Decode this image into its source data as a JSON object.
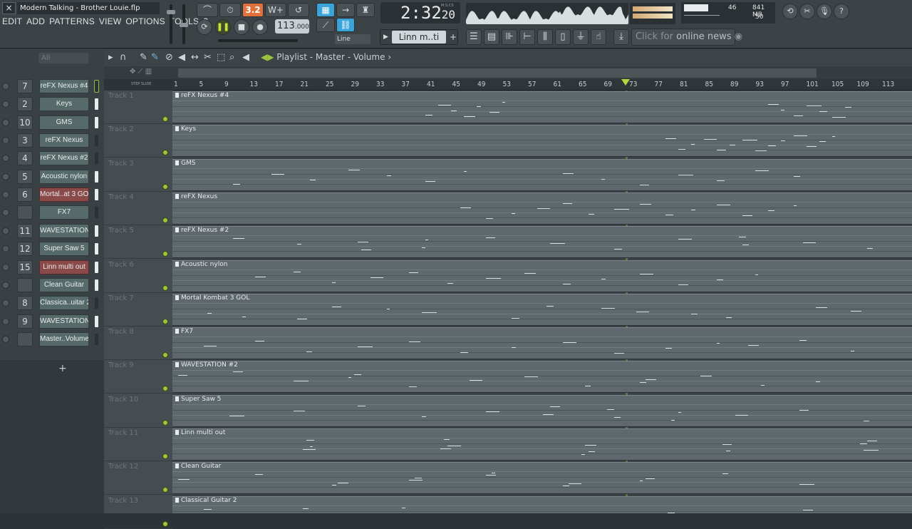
{
  "window": {
    "title": "Modern Talking - Brother Louie.flp",
    "close_label": "×"
  },
  "menu": [
    "EDIT",
    "ADD",
    "PATTERNS",
    "VIEW",
    "OPTIONS",
    "TOOLS",
    "?"
  ],
  "transport": {
    "tempo_int": "113",
    "tempo_frac": ".000",
    "time_main": "2:32",
    "time_sub": "20",
    "time_unit": "M:S:CS",
    "snap": "3.2",
    "line_mode": "Line",
    "pattern_name": "Linn m..ti out"
  },
  "status": {
    "cpu": "46",
    "memory": "841 MB",
    "polyphony": "50"
  },
  "news": {
    "prefix": "Click for",
    "link": "online news"
  },
  "channel_filter": "All",
  "channels": [
    {
      "num": "7",
      "name": "reFX Nexus #4",
      "style": "normal",
      "selected": "green"
    },
    {
      "num": "2",
      "name": "Keys",
      "style": "normal",
      "selected": "on"
    },
    {
      "num": "10",
      "name": "GMS",
      "style": "normal",
      "selected": "on"
    },
    {
      "num": "3",
      "name": "reFX Nexus",
      "style": "normal",
      "selected": "off"
    },
    {
      "num": "4",
      "name": "reFX Nexus #2",
      "style": "normal",
      "selected": "off"
    },
    {
      "num": "5",
      "name": "Acoustic nylon",
      "style": "normal",
      "selected": "on"
    },
    {
      "num": "6",
      "name": "Mortal..at 3 GOL",
      "style": "red",
      "selected": "on"
    },
    {
      "num": "",
      "name": "FX7",
      "style": "normal",
      "selected": "off"
    },
    {
      "num": "11",
      "name": "WAVESTATION #2",
      "style": "normal",
      "selected": "on"
    },
    {
      "num": "12",
      "name": "Super Saw 5",
      "style": "normal",
      "selected": "on"
    },
    {
      "num": "15",
      "name": "Linn multi out",
      "style": "red",
      "selected": "on"
    },
    {
      "num": "",
      "name": "Clean Guitar",
      "style": "normal",
      "selected": "on"
    },
    {
      "num": "8",
      "name": "Classica..uitar 2",
      "style": "normal",
      "selected": "off"
    },
    {
      "num": "9",
      "name": "WAVESTATION",
      "style": "normal",
      "selected": "on"
    },
    {
      "num": "",
      "name": "Master..Volume",
      "style": "normal",
      "selected": "off"
    }
  ],
  "add_channel": "+",
  "playlist": {
    "title": "Playlist - Master - Volume",
    "step_label": "STEP SLIDE",
    "ruler": [
      "1",
      "5",
      "9",
      "13",
      "17",
      "21",
      "25",
      "29",
      "33",
      "37",
      "41",
      "45",
      "49",
      "53",
      "57",
      "61",
      "65",
      "69",
      "73",
      "77",
      "81",
      "85",
      "89",
      "93",
      "97",
      "101",
      "105",
      "109",
      "113"
    ],
    "tracks": [
      {
        "label": "Track 1",
        "clip": "reFX Nexus #4"
      },
      {
        "label": "Track 2",
        "clip": "Keys"
      },
      {
        "label": "Track 3",
        "clip": "GMS"
      },
      {
        "label": "Track 4",
        "clip": "reFX Nexus"
      },
      {
        "label": "Track 5",
        "clip": "reFX Nexus #2"
      },
      {
        "label": "Track 6",
        "clip": "Acoustic nylon"
      },
      {
        "label": "Track 7",
        "clip": "Mortal Kombat 3 GOL"
      },
      {
        "label": "Track 8",
        "clip": "FX7"
      },
      {
        "label": "Track 9",
        "clip": "WAVESTATION #2"
      },
      {
        "label": "Track 10",
        "clip": "Super Saw 5"
      },
      {
        "label": "Track 11",
        "clip": "Linn multi out"
      },
      {
        "label": "Track 12",
        "clip": "Clean Guitar"
      },
      {
        "label": "Track 13",
        "clip": "Classical Guitar 2"
      }
    ]
  },
  "colors": {
    "accent_green": "#9dc43b",
    "accent_orange": "#e0703c",
    "accent_blue": "#3aa4d8",
    "channel_teal": "#566a6a",
    "channel_red": "#8a4a4a"
  }
}
